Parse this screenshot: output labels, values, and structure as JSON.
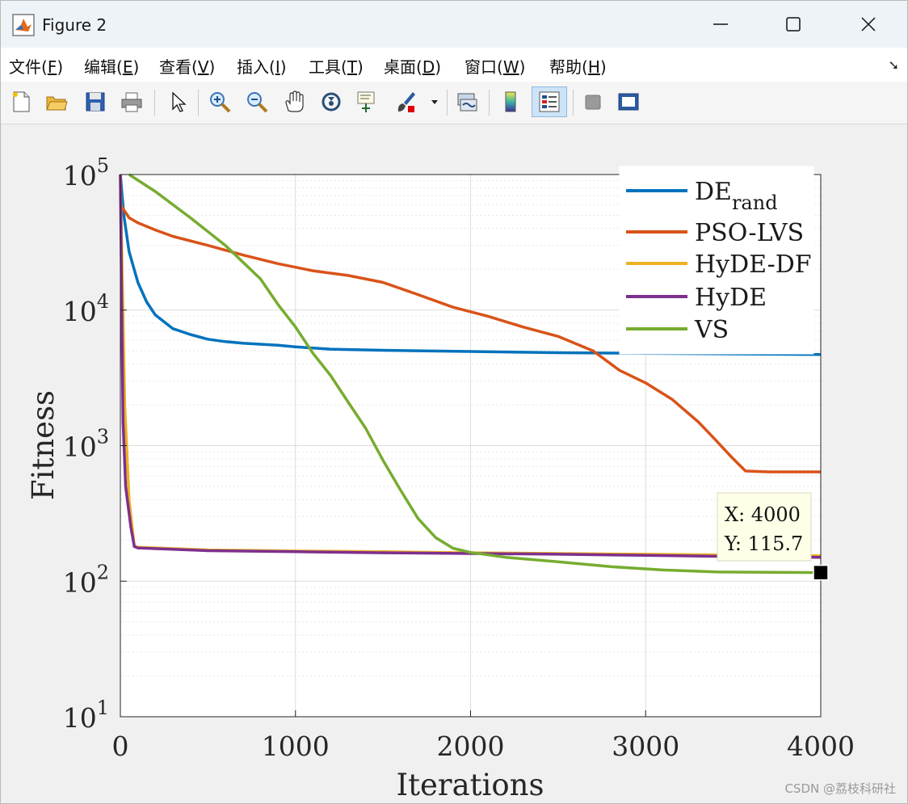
{
  "window": {
    "title": "Figure 2",
    "menu": [
      {
        "label": "文件(",
        "key": "F",
        "tail": ")"
      },
      {
        "label": "编辑(",
        "key": "E",
        "tail": ")"
      },
      {
        "label": "查看(",
        "key": "V",
        "tail": ")"
      },
      {
        "label": "插入(",
        "key": "I",
        "tail": ")"
      },
      {
        "label": "工具(",
        "key": "T",
        "tail": ")"
      },
      {
        "label": "桌面(",
        "key": "D",
        "tail": ")"
      },
      {
        "label": "窗口(",
        "key": "W",
        "tail": ")"
      },
      {
        "label": "帮助(",
        "key": "H",
        "tail": ")"
      }
    ],
    "toolbar_icons": [
      "new-figure-icon",
      "open-file-icon",
      "save-icon",
      "print-icon",
      "pointer-icon",
      "zoom-in-icon",
      "zoom-out-icon",
      "pan-hand-icon",
      "rotate-3d-icon",
      "data-cursor-icon",
      "brush-icon",
      "brush-dropdown-icon",
      "link-plot-icon",
      "colorbar-icon",
      "legend-icon",
      "hide-plot-tools-icon",
      "show-plot-tools-icon"
    ],
    "watermark": "CSDN @荔枝科研社"
  },
  "colors": {
    "DE": "#0072bd",
    "PSO": "#d95319",
    "HyDEDF": "#edb120",
    "HyDE": "#7e2f8e",
    "VS": "#77ac30"
  },
  "chart_data": {
    "type": "line",
    "xlabel": "Iterations",
    "ylabel": "Fitness",
    "xlim": [
      0,
      4000
    ],
    "ylim": [
      10,
      100000
    ],
    "yscale": "log",
    "xticks": [
      "0",
      "1000",
      "2000",
      "3000",
      "4000"
    ],
    "yticks": [
      {
        "base": "10",
        "exp": "1",
        "value": 10
      },
      {
        "base": "10",
        "exp": "2",
        "value": 100
      },
      {
        "base": "10",
        "exp": "3",
        "value": 1000
      },
      {
        "base": "10",
        "exp": "4",
        "value": 10000
      },
      {
        "base": "10",
        "exp": "5",
        "value": 100000
      }
    ],
    "grid": true,
    "legend_position": "top-right",
    "series": [
      {
        "name": "DE",
        "sub": "rand",
        "color_key": "DE",
        "points": [
          [
            0,
            100000
          ],
          [
            20,
            50000
          ],
          [
            50,
            27000
          ],
          [
            100,
            16000
          ],
          [
            150,
            11500
          ],
          [
            200,
            9200
          ],
          [
            300,
            7300
          ],
          [
            400,
            6600
          ],
          [
            500,
            6100
          ],
          [
            600,
            5850
          ],
          [
            700,
            5700
          ],
          [
            800,
            5600
          ],
          [
            900,
            5500
          ],
          [
            1000,
            5350
          ],
          [
            1200,
            5150
          ],
          [
            1500,
            5050
          ],
          [
            2000,
            4950
          ],
          [
            2500,
            4850
          ],
          [
            3000,
            4800
          ],
          [
            3500,
            4750
          ],
          [
            4000,
            4700
          ]
        ]
      },
      {
        "name": "PSO-LVS",
        "sub": "",
        "color_key": "PSO",
        "points": [
          [
            0,
            60000
          ],
          [
            50,
            48000
          ],
          [
            100,
            44000
          ],
          [
            200,
            39000
          ],
          [
            300,
            35000
          ],
          [
            500,
            30000
          ],
          [
            700,
            25500
          ],
          [
            900,
            22000
          ],
          [
            1100,
            19500
          ],
          [
            1300,
            18000
          ],
          [
            1500,
            16000
          ],
          [
            1700,
            13000
          ],
          [
            1900,
            10500
          ],
          [
            2100,
            9000
          ],
          [
            2300,
            7500
          ],
          [
            2500,
            6400
          ],
          [
            2700,
            5000
          ],
          [
            2850,
            3600
          ],
          [
            3000,
            2900
          ],
          [
            3150,
            2200
          ],
          [
            3300,
            1500
          ],
          [
            3400,
            1100
          ],
          [
            3500,
            800
          ],
          [
            3570,
            650
          ],
          [
            3700,
            640
          ],
          [
            4000,
            640
          ]
        ]
      },
      {
        "name": "HyDE-DF",
        "sub": "",
        "color_key": "HyDEDF",
        "points": [
          [
            0,
            100000
          ],
          [
            10,
            20000
          ],
          [
            25,
            2000
          ],
          [
            50,
            400
          ],
          [
            80,
            180
          ],
          [
            100,
            178
          ],
          [
            500,
            170
          ],
          [
            1000,
            167
          ],
          [
            1500,
            165
          ],
          [
            2000,
            162
          ],
          [
            2500,
            160
          ],
          [
            3000,
            158
          ],
          [
            3500,
            156
          ],
          [
            4000,
            154
          ]
        ]
      },
      {
        "name": "HyDE",
        "sub": "",
        "color_key": "HyDE",
        "points": [
          [
            0,
            100000
          ],
          [
            8,
            10000
          ],
          [
            15,
            1500
          ],
          [
            30,
            500
          ],
          [
            60,
            250
          ],
          [
            80,
            180
          ],
          [
            100,
            176
          ],
          [
            500,
            168
          ],
          [
            1000,
            165
          ],
          [
            1500,
            162
          ],
          [
            2000,
            160
          ],
          [
            2500,
            158
          ],
          [
            3000,
            155
          ],
          [
            3500,
            152
          ],
          [
            4000,
            150
          ]
        ]
      },
      {
        "name": "VS",
        "sub": "",
        "color_key": "VS",
        "points": [
          [
            50,
            100000
          ],
          [
            200,
            75000
          ],
          [
            400,
            48000
          ],
          [
            600,
            30000
          ],
          [
            800,
            17000
          ],
          [
            900,
            11000
          ],
          [
            1000,
            7500
          ],
          [
            1100,
            4800
          ],
          [
            1200,
            3300
          ],
          [
            1300,
            2100
          ],
          [
            1400,
            1350
          ],
          [
            1500,
            780
          ],
          [
            1600,
            470
          ],
          [
            1700,
            290
          ],
          [
            1800,
            210
          ],
          [
            1900,
            175
          ],
          [
            2000,
            163
          ],
          [
            2200,
            150
          ],
          [
            2500,
            139
          ],
          [
            2800,
            128
          ],
          [
            3100,
            121
          ],
          [
            3400,
            117
          ],
          [
            4000,
            115.7
          ]
        ]
      }
    ],
    "datatip": {
      "x": 4000,
      "y": 115.7,
      "x_text": "X: 4000",
      "y_text": "Y: 115.7"
    }
  }
}
